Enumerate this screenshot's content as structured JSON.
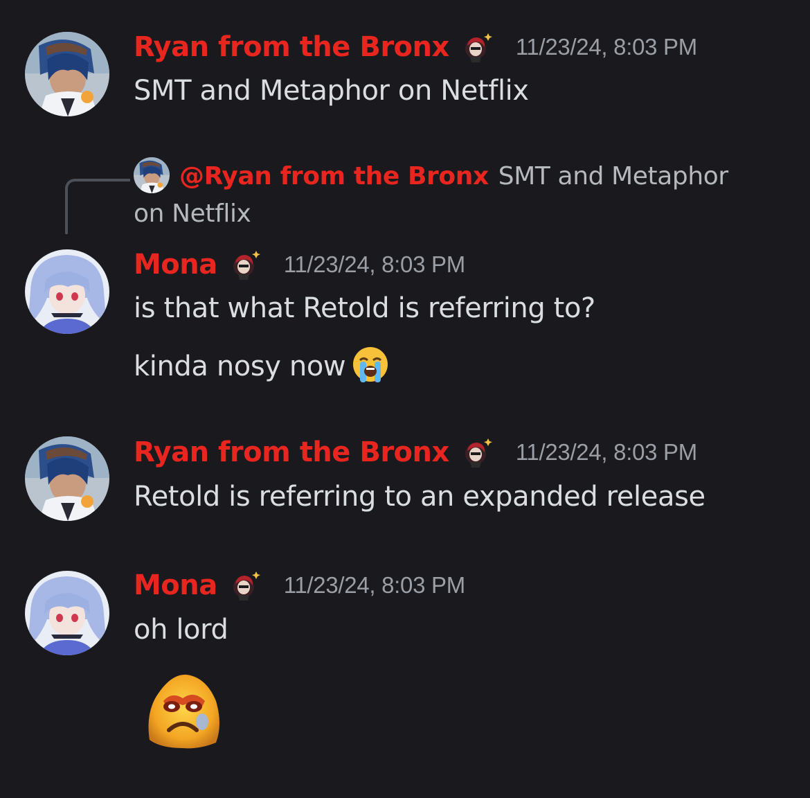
{
  "colors": {
    "background": "#1a1a1e",
    "username": "#e8251f",
    "timestamp": "#9b9ea4",
    "message_text": "#dbdee1",
    "reply_text": "#b5b8bd"
  },
  "messages": [
    {
      "author": "Ryan from the Bronx",
      "avatar": "ryan-avatar",
      "badge": "role-badge-icon",
      "timestamp": "11/23/24, 8:03 PM",
      "lines": [
        "SMT and Metaphor on Netflix"
      ]
    },
    {
      "reply_to": {
        "mention": "@Ryan from the Bronx",
        "text": "SMT and Metaphor on Netflix"
      },
      "author": "Mona",
      "avatar": "mona-avatar",
      "badge": "role-badge-icon",
      "timestamp": "11/23/24, 8:03 PM",
      "lines": [
        "is that what Retold is referring to?",
        "kinda nosy now"
      ],
      "line_emoji": "loudly-crying-face-emoji"
    },
    {
      "author": "Ryan from the Bronx",
      "avatar": "ryan-avatar",
      "badge": "role-badge-icon",
      "timestamp": "11/23/24, 8:03 PM",
      "lines": [
        "Retold is referring to an expanded release"
      ]
    },
    {
      "author": "Mona",
      "avatar": "mona-avatar",
      "badge": "role-badge-icon",
      "timestamp": "11/23/24, 8:03 PM",
      "lines": [
        "oh lord"
      ],
      "custom_emoji": "distressed-face-emoji"
    }
  ]
}
